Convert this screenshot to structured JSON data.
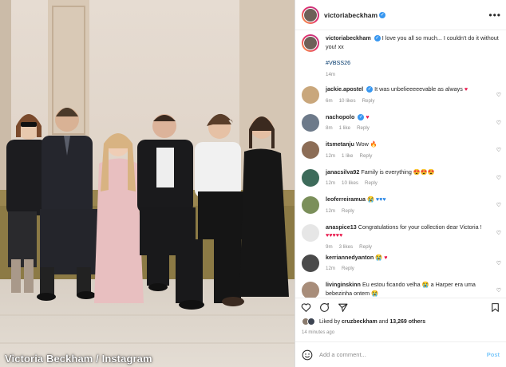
{
  "photo": {
    "credit": "Victoria Beckham / Instagram"
  },
  "post": {
    "username": "victoriabeckham",
    "caption_text": "I love you all so much... I couldn't do it without you! xx",
    "hashtag": "#VBSS26",
    "caption_time": "14m"
  },
  "comments": [
    {
      "user": "jackie.apostel",
      "verified": true,
      "text": "It was unbelieeeeevable as always ",
      "emoji": "♥",
      "emoji_color": "red",
      "time": "6m",
      "likes": "10 likes",
      "reply": "Reply",
      "avatar_color": "#c9a77c"
    },
    {
      "user": "nachopolo",
      "verified": true,
      "text": "",
      "emoji": "♥",
      "emoji_color": "red",
      "time": "8m",
      "likes": "1 like",
      "reply": "Reply",
      "avatar_color": "#6d7a8a"
    },
    {
      "user": "itsmetanju",
      "verified": false,
      "text": "Wow ",
      "emoji": "🔥",
      "emoji_color": "red",
      "time": "12m",
      "likes": "1 like",
      "reply": "Reply",
      "avatar_color": "#8c6d56"
    },
    {
      "user": "janacsilva92",
      "verified": false,
      "text": "Family is everything ",
      "emoji": "😍😍😍",
      "emoji_color": "red",
      "time": "12m",
      "likes": "10 likes",
      "reply": "Reply",
      "avatar_color": "#3d6b5a"
    },
    {
      "user": "leoferreiramua",
      "verified": false,
      "text": "",
      "emoji": "😭 ♥♥♥",
      "emoji_color": "blue",
      "time": "12m",
      "likes": "",
      "reply": "Reply",
      "avatar_color": "#7b8f5a"
    },
    {
      "user": "anaspice13",
      "verified": false,
      "text": "Congratulations for your collection dear Victoria ! ",
      "emoji": "♥♥♥♥♥",
      "emoji_color": "red",
      "time": "9m",
      "likes": "3 likes",
      "reply": "Reply",
      "avatar_color": "#e6e6e6"
    },
    {
      "user": "kerriannedyanton",
      "verified": false,
      "text": "",
      "emoji": "😭 ♥",
      "emoji_color": "red",
      "time": "12m",
      "likes": "",
      "reply": "Reply",
      "avatar_color": "#4a4a4a"
    },
    {
      "user": "livinginskinn",
      "verified": false,
      "text": "Eu estou ficando velha 😭 a Harper era uma bebezinha ontem 😭",
      "emoji": "",
      "emoji_color": "red",
      "time": "",
      "likes": "",
      "reply": "",
      "avatar_color": "#a88d7a"
    }
  ],
  "actions": {
    "icons": [
      "heart-icon",
      "comment-icon",
      "share-icon",
      "bookmark-icon"
    ]
  },
  "likes": {
    "prefix": "Liked by",
    "user": "cruzbeckham",
    "mid": "and",
    "count": "13,269 others"
  },
  "post_time": "14 minutes ago",
  "add_comment": {
    "placeholder": "Add a comment...",
    "post_label": "Post"
  },
  "colors": {
    "accent": "#0095f6",
    "verified": "#3897f0",
    "like_red": "#e8194c"
  }
}
